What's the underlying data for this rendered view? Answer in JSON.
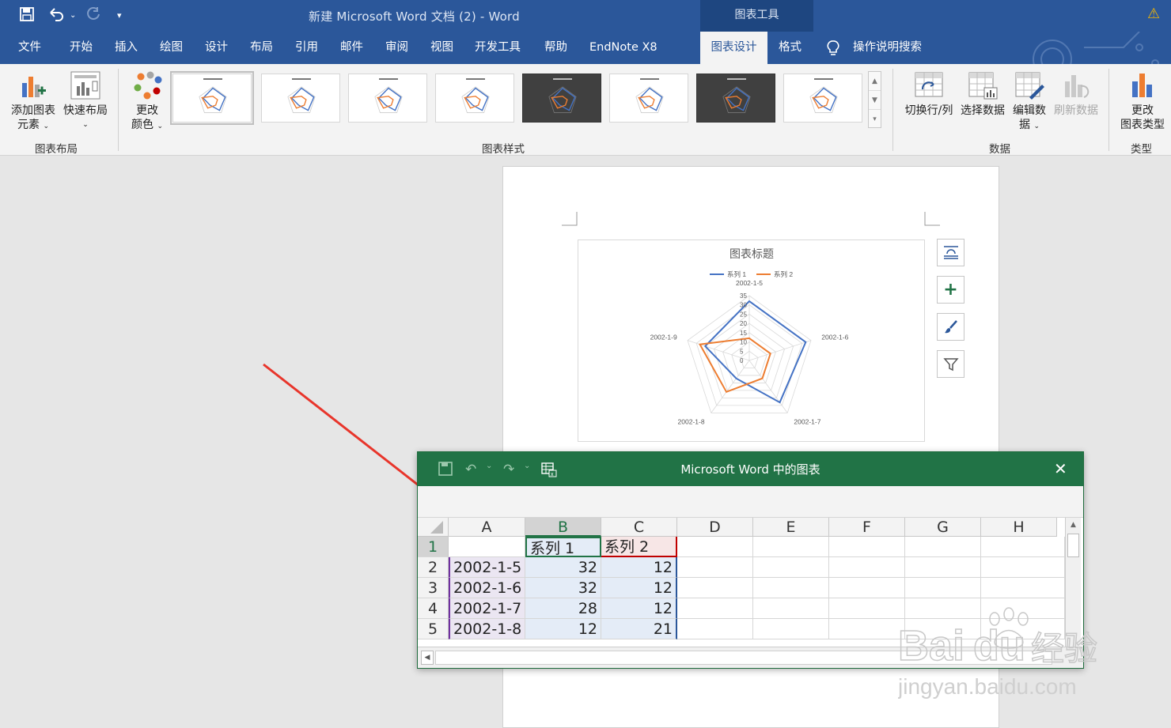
{
  "titlebar": {
    "doc_title": "新建 Microsoft Word 文档 (2)  -  Word",
    "context_tools": "图表工具"
  },
  "menu": {
    "tabs": [
      "文件",
      "开始",
      "插入",
      "绘图",
      "设计",
      "布局",
      "引用",
      "邮件",
      "审阅",
      "视图",
      "开发工具",
      "帮助",
      "EndNote X8",
      "图表设计",
      "格式"
    ],
    "active_tab": "图表设计",
    "search": "操作说明搜索"
  },
  "ribbon": {
    "add_element_line1": "添加图表",
    "add_element_line2": "元素",
    "quick_layout": "快速布局",
    "change_colors_line1": "更改",
    "change_colors_line2": "颜色",
    "group_layout": "图表布局",
    "group_styles": "图表样式",
    "switch_rowcol": "切换行/列",
    "select_data": "选择数据",
    "edit_data_line1": "编辑数",
    "edit_data_line2": "据",
    "refresh_data": "刷新数据",
    "group_data": "数据",
    "change_type_line1": "更改",
    "change_type_line2": "图表类型",
    "group_type": "类型"
  },
  "chart_data": {
    "type": "radar",
    "title": "图表标题",
    "categories": [
      "2002-1-5",
      "2002-1-6",
      "2002-1-7",
      "2002-1-8",
      "2002-1-9"
    ],
    "series": [
      {
        "name": "系列 1",
        "values": [
          32,
          32,
          28,
          12,
          25
        ],
        "color": "#4472c4"
      },
      {
        "name": "系列 2",
        "values": [
          12,
          12,
          12,
          21,
          28
        ],
        "color": "#ed7d31"
      }
    ],
    "r_ticks": [
      "35",
      "30",
      "25",
      "20",
      "15",
      "10",
      "5",
      "0"
    ],
    "r_max": 35,
    "legend_position": "top"
  },
  "excel": {
    "title": "Microsoft Word 中的图表",
    "columns": [
      "A",
      "B",
      "C",
      "D",
      "E",
      "F",
      "G",
      "H"
    ],
    "rows": [
      [
        "",
        "系列 1",
        "系列 2"
      ],
      [
        "2002-1-5",
        "32",
        "12"
      ],
      [
        "2002-1-6",
        "32",
        "12"
      ],
      [
        "2002-1-7",
        "28",
        "12"
      ],
      [
        "2002-1-8",
        "12",
        "21"
      ]
    ],
    "row_numbers": [
      "1",
      "2",
      "3",
      "4",
      "5"
    ]
  },
  "watermark": {
    "brand": "Bai",
    "brand2": "du",
    "product": "经验",
    "url": "jingyan.baidu.com"
  }
}
